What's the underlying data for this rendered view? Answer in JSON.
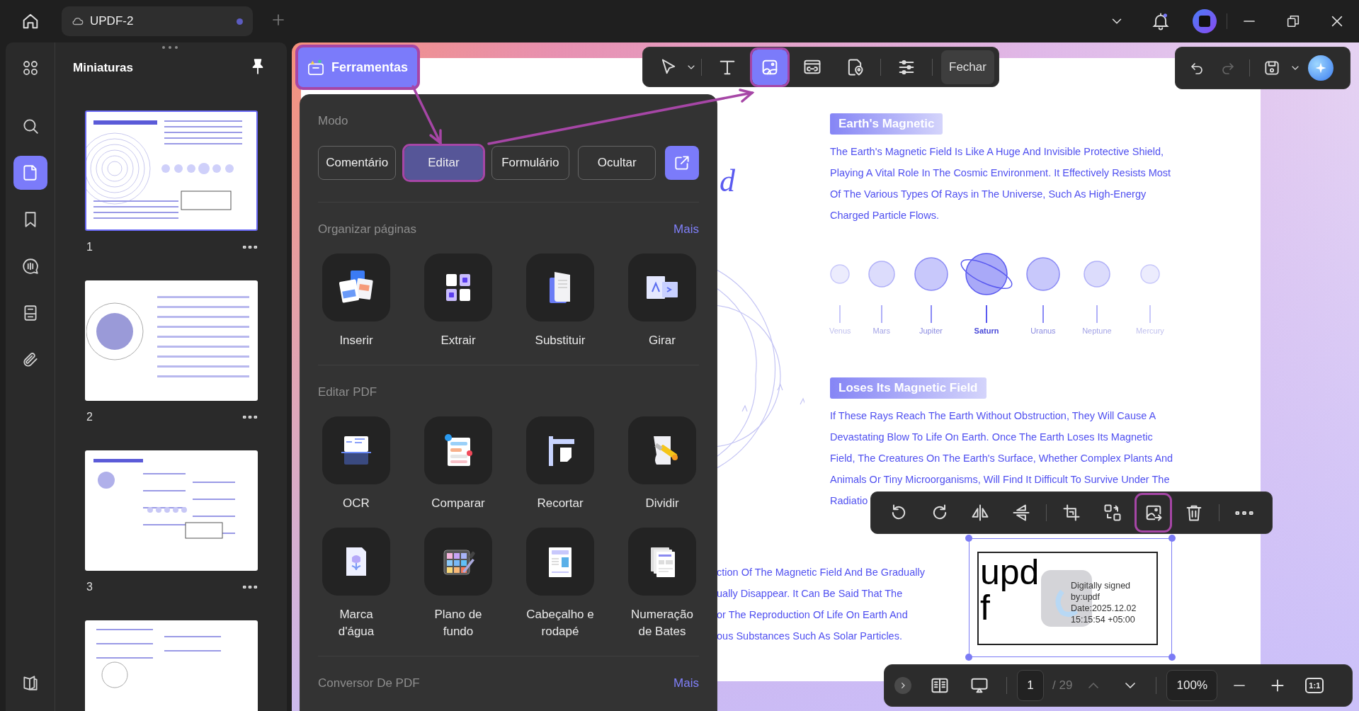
{
  "title_bar": {
    "tab": {
      "label": "UPDF-2",
      "modified": true
    },
    "notification": true
  },
  "sidebar": {
    "items": [
      {
        "kind": "overview",
        "selected": false
      },
      {
        "kind": "search",
        "selected": false
      },
      {
        "kind": "pages",
        "selected": true
      },
      {
        "kind": "bookmarks",
        "selected": false
      },
      {
        "kind": "comments",
        "selected": false
      },
      {
        "kind": "forms",
        "selected": false
      },
      {
        "kind": "attachments",
        "selected": false
      },
      {
        "kind": "layers",
        "selected": false
      }
    ]
  },
  "thumbnails": {
    "title": "Miniaturas",
    "pages": [
      {
        "label": "1",
        "selected": true
      },
      {
        "label": "2",
        "selected": false
      },
      {
        "label": "3",
        "selected": false
      },
      {
        "selected": false
      }
    ]
  },
  "tools_button": {
    "label": "Ferramentas",
    "highlighted": true
  },
  "edit_toolbar": {
    "groups": [
      [
        {
          "kind": "pointer",
          "selected": false,
          "highlighted": false
        }
      ],
      [
        {
          "kind": "text",
          "selected": false,
          "highlighted": false
        },
        {
          "kind": "image",
          "selected": true,
          "highlighted": true
        },
        {
          "kind": "link",
          "selected": false,
          "highlighted": false
        },
        {
          "kind": "stamp",
          "selected": false,
          "highlighted": false
        }
      ],
      [
        {
          "kind": "properties",
          "selected": false,
          "highlighted": false
        }
      ]
    ],
    "close": "Fechar"
  },
  "history": [
    {
      "kind": "undo",
      "disabled": false
    },
    {
      "kind": "redo",
      "disabled": true
    }
  ],
  "tools_menu": {
    "mode": {
      "title": "Modo",
      "options": [
        {
          "label": "Comentário",
          "selected": false,
          "highlighted": false
        },
        {
          "label": "Editar",
          "selected": true,
          "highlighted": true
        },
        {
          "label": "Formulário",
          "selected": false,
          "highlighted": false
        },
        {
          "label": "Ocultar",
          "selected": false,
          "highlighted": false
        }
      ]
    },
    "sections": [
      {
        "title": "Organizar páginas",
        "more": "Mais",
        "tools": [
          {
            "label": "Inserir"
          },
          {
            "label": "Extrair"
          },
          {
            "label": "Substituir"
          },
          {
            "label": "Girar"
          }
        ]
      },
      {
        "title": "Editar PDF",
        "tools": [
          {
            "label": "OCR"
          },
          {
            "label": "Comparar"
          },
          {
            "label": "Recortar"
          },
          {
            "label": "Dividir"
          },
          {
            "label": "Marca\nd'água"
          },
          {
            "label": "Plano de\nfundo"
          },
          {
            "label": "Cabeçalho e\nrodapé"
          },
          {
            "label": "Numeração\nde Bates"
          }
        ]
      },
      {
        "title": "Conversor De PDF",
        "more": "Mais"
      }
    ]
  },
  "document": {
    "cut_letter": "d",
    "sections": [
      {
        "heading": "Earth's Magnetic",
        "lines": [
          "The Earth's Magnetic Field Is Like A Huge And Invisible Protective Shield,",
          "Playing A Vital Role In The Cosmic Environment. It Effectively Resists Most",
          "Of The Various Types Of Rays in The Universe, Such As High-Energy",
          "Charged Particle Flows."
        ]
      },
      {
        "heading": "Loses Its Magnetic Field",
        "lines": [
          "If These Rays Reach The Earth Without Obstruction, They Will Cause A",
          "Devastating Blow To Life On Earth. Once The Earth Loses Its Magnetic",
          "Field, The Creatures On The Earth's Surface, Whether Complex Plants And",
          "Animals Or Tiny Microorganisms, Will Find It Difficult To Survive Under The",
          "Radiatio"
        ]
      }
    ],
    "planets": [
      {
        "name": "Venus",
        "selected": false
      },
      {
        "name": "Mars",
        "selected": false
      },
      {
        "name": "Jupiter",
        "selected": false
      },
      {
        "name": "Saturn",
        "selected": true
      },
      {
        "name": "Uranus",
        "selected": false
      },
      {
        "name": "Neptune",
        "selected": false
      },
      {
        "name": "Mercury",
        "selected": false
      }
    ],
    "side_lines": [
      "ction Of The Magnetic Field And Be Gradually",
      "ually Disappear. It Can Be Said That The",
      "or The Reproduction Of Life On Earth And",
      "ous Substances Such As Solar Particles."
    ],
    "signature": {
      "initials": [
        "upd",
        "f"
      ],
      "details": [
        "Digitally signed",
        "by:updf",
        "Date:2025.12.02",
        "15:15:54 +05:00"
      ]
    }
  },
  "image_toolbar": {
    "groups": [
      [
        {
          "kind": "rotate-left",
          "highlighted": false
        },
        {
          "kind": "rotate-right",
          "highlighted": false
        },
        {
          "kind": "flip-horizontal",
          "highlighted": false
        },
        {
          "kind": "flip-vertical",
          "highlighted": false
        }
      ],
      [
        {
          "kind": "crop",
          "highlighted": false
        },
        {
          "kind": "replace",
          "highlighted": false
        },
        {
          "kind": "extract",
          "highlighted": true
        },
        {
          "kind": "delete",
          "highlighted": false
        }
      ],
      [
        {
          "kind": "more",
          "highlighted": false
        }
      ]
    ]
  },
  "page_nav": {
    "page": "1",
    "total": "/ 29",
    "previous_disabled": true,
    "zoom": "100%",
    "actual_size": "1:1"
  }
}
